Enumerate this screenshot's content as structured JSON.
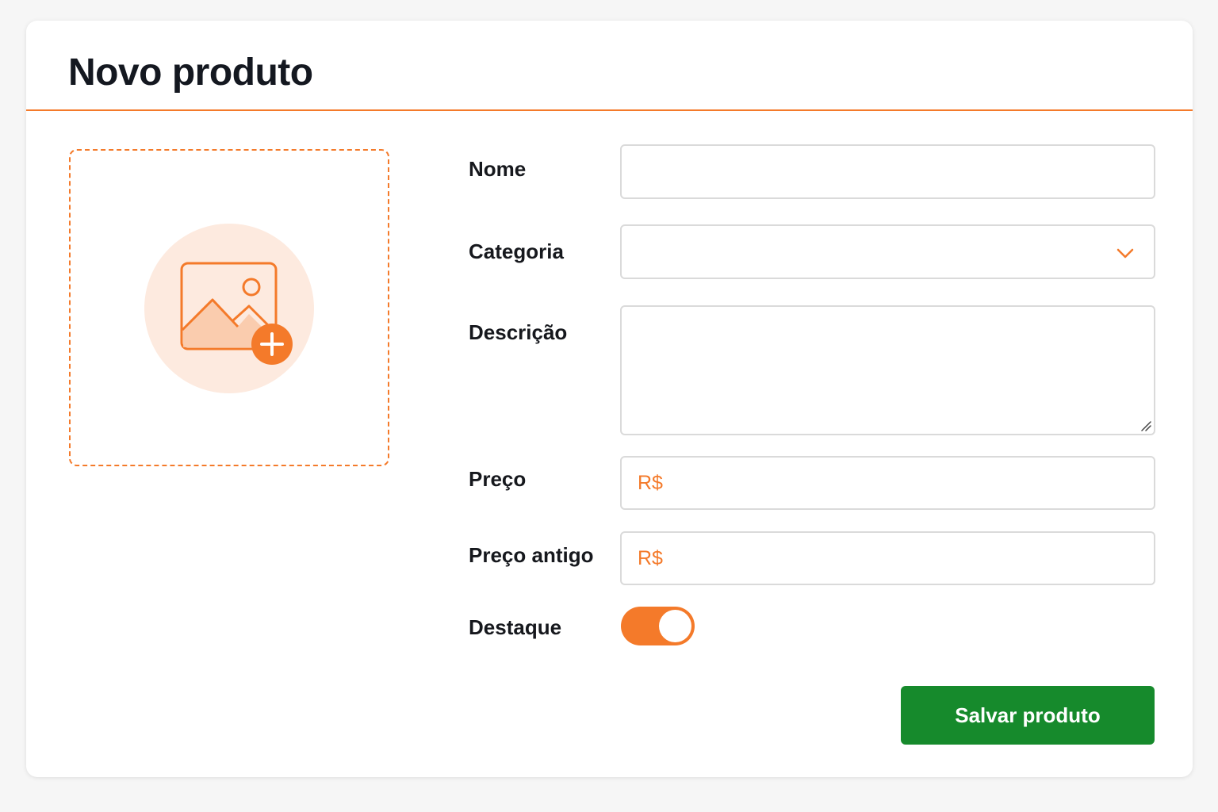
{
  "page": {
    "title": "Novo produto"
  },
  "upload": {
    "icon": "image-add-icon"
  },
  "form": {
    "name": {
      "label": "Nome",
      "value": ""
    },
    "category": {
      "label": "Categoria",
      "selected": "",
      "icon": "chevron-down-icon"
    },
    "description": {
      "label": "Descrição",
      "value": ""
    },
    "price": {
      "label": "Preço",
      "currency": "R$",
      "value": ""
    },
    "old_price": {
      "label": "Preço antigo",
      "currency": "R$",
      "value": ""
    },
    "featured": {
      "label": "Destaque",
      "on": true
    }
  },
  "actions": {
    "save_label": "Salvar produto"
  },
  "colors": {
    "accent": "#f47a2a",
    "accent_light": "#fdeadf",
    "primary_button": "#168a2c",
    "text": "#16181d",
    "border": "#dadada"
  }
}
